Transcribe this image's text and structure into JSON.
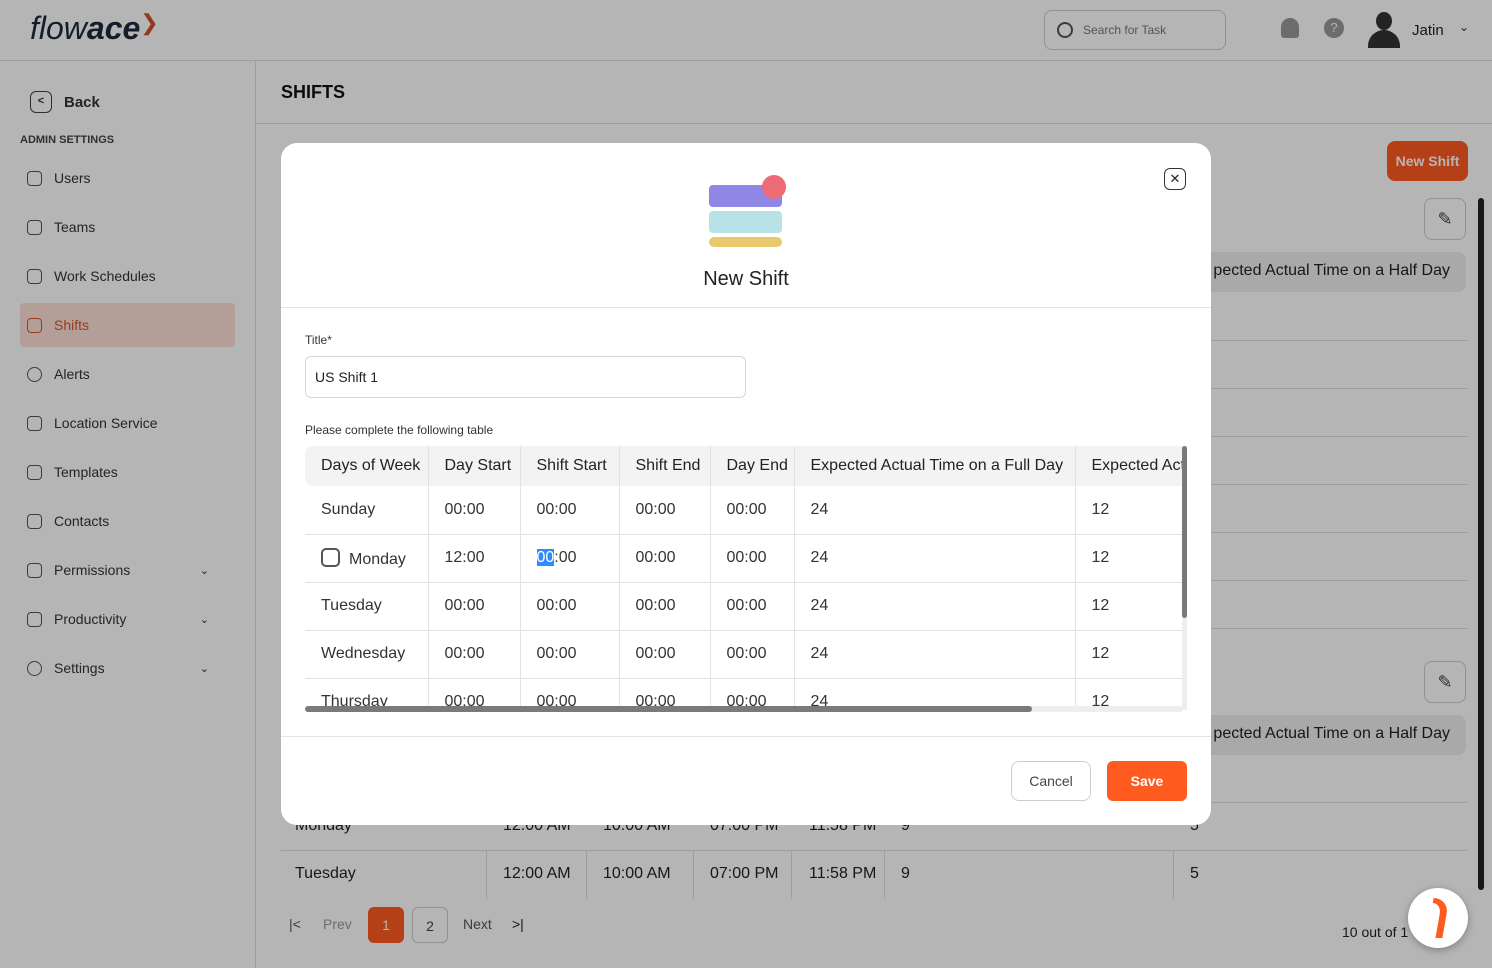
{
  "header": {
    "logo": "flowace",
    "search_placeholder": "Search for Task",
    "user_name": "Jatin"
  },
  "sidebar": {
    "back": "Back",
    "section": "ADMIN SETTINGS",
    "items": [
      {
        "label": "Users"
      },
      {
        "label": "Teams"
      },
      {
        "label": "Work Schedules"
      },
      {
        "label": "Shifts",
        "active": true
      },
      {
        "label": "Alerts"
      },
      {
        "label": "Location Service"
      },
      {
        "label": "Templates"
      },
      {
        "label": "Contacts"
      },
      {
        "label": "Permissions",
        "expandable": true
      },
      {
        "label": "Productivity",
        "expandable": true
      },
      {
        "label": "Settings",
        "expandable": true
      }
    ]
  },
  "page": {
    "title": "SHIFTS",
    "new_shift": "New Shift",
    "half_day_header": "pected Actual Time on a Half Day",
    "bg_rows": [
      {
        "day": "Monday",
        "day_start": "12:00 AM",
        "shift_start": "10:00 AM",
        "shift_end": "07:00 PM",
        "day_end": "11:58 PM",
        "full": "9",
        "half": "5"
      },
      {
        "day": "Tuesday",
        "day_start": "12:00 AM",
        "shift_start": "10:00 AM",
        "shift_end": "07:00 PM",
        "day_end": "11:58 PM",
        "full": "9",
        "half": "5"
      }
    ],
    "pagination": {
      "prev": "Prev",
      "next": "Next",
      "pages": [
        "1",
        "2"
      ],
      "current": "1",
      "count": "10 out of 1"
    }
  },
  "modal": {
    "title": "New Shift",
    "title_label": "Title*",
    "title_value": "US Shift 1",
    "table_label": "Please complete the following table",
    "columns": [
      "Days of Week",
      "Day Start",
      "Shift Start",
      "Shift End",
      "Day End",
      "Expected Actual Time on a Full Day",
      "Expected Actual Time on a Half Day"
    ],
    "rows": [
      {
        "day": "Sunday",
        "day_start": "00:00",
        "shift_start": "00:00",
        "shift_end": "00:00",
        "day_end": "00:00",
        "full": "24",
        "half": "12"
      },
      {
        "day": "Monday",
        "day_start": "12:00",
        "shift_start_sel": "00",
        "shift_start_rest": ":00",
        "shift_end": "00:00",
        "day_end": "00:00",
        "full": "24",
        "half": "12",
        "checkbox": false
      },
      {
        "day": "Tuesday",
        "day_start": "00:00",
        "shift_start": "00:00",
        "shift_end": "00:00",
        "day_end": "00:00",
        "full": "24",
        "half": "12"
      },
      {
        "day": "Wednesday",
        "day_start": "00:00",
        "shift_start": "00:00",
        "shift_end": "00:00",
        "day_end": "00:00",
        "full": "24",
        "half": "12"
      },
      {
        "day": "Thursday",
        "day_start": "00:00",
        "shift_start": "00:00",
        "shift_end": "00:00",
        "day_end": "00:00",
        "full": "24",
        "half": "12"
      }
    ],
    "cancel": "Cancel",
    "save": "Save"
  },
  "colors": {
    "accent": "#ff5a1f",
    "selection": "#2f8cff"
  }
}
